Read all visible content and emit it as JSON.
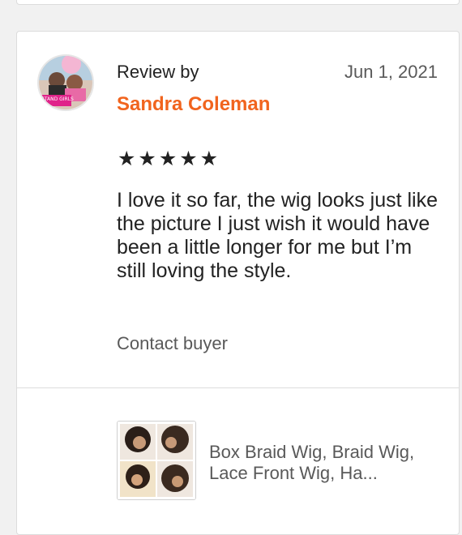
{
  "review": {
    "heading": "Review by",
    "date": "Jun 1, 2021",
    "reviewer_name": "Sandra Coleman",
    "rating": 5,
    "stars": "★★★★★",
    "text": "I love it so far, the wig looks just like the picture I just wish it would have been a little longer for me but I’m still loving the style.",
    "contact_label": "Contact buyer",
    "avatar_text": "STAND GIRLS"
  },
  "product": {
    "title": "Box Braid Wig, Braid Wig, Lace Front Wig, Ha..."
  },
  "colors": {
    "accent": "#f1641e",
    "text": "#222222",
    "muted": "#595959",
    "border": "#dcdcdc",
    "page_bg": "#f1f1f1"
  }
}
